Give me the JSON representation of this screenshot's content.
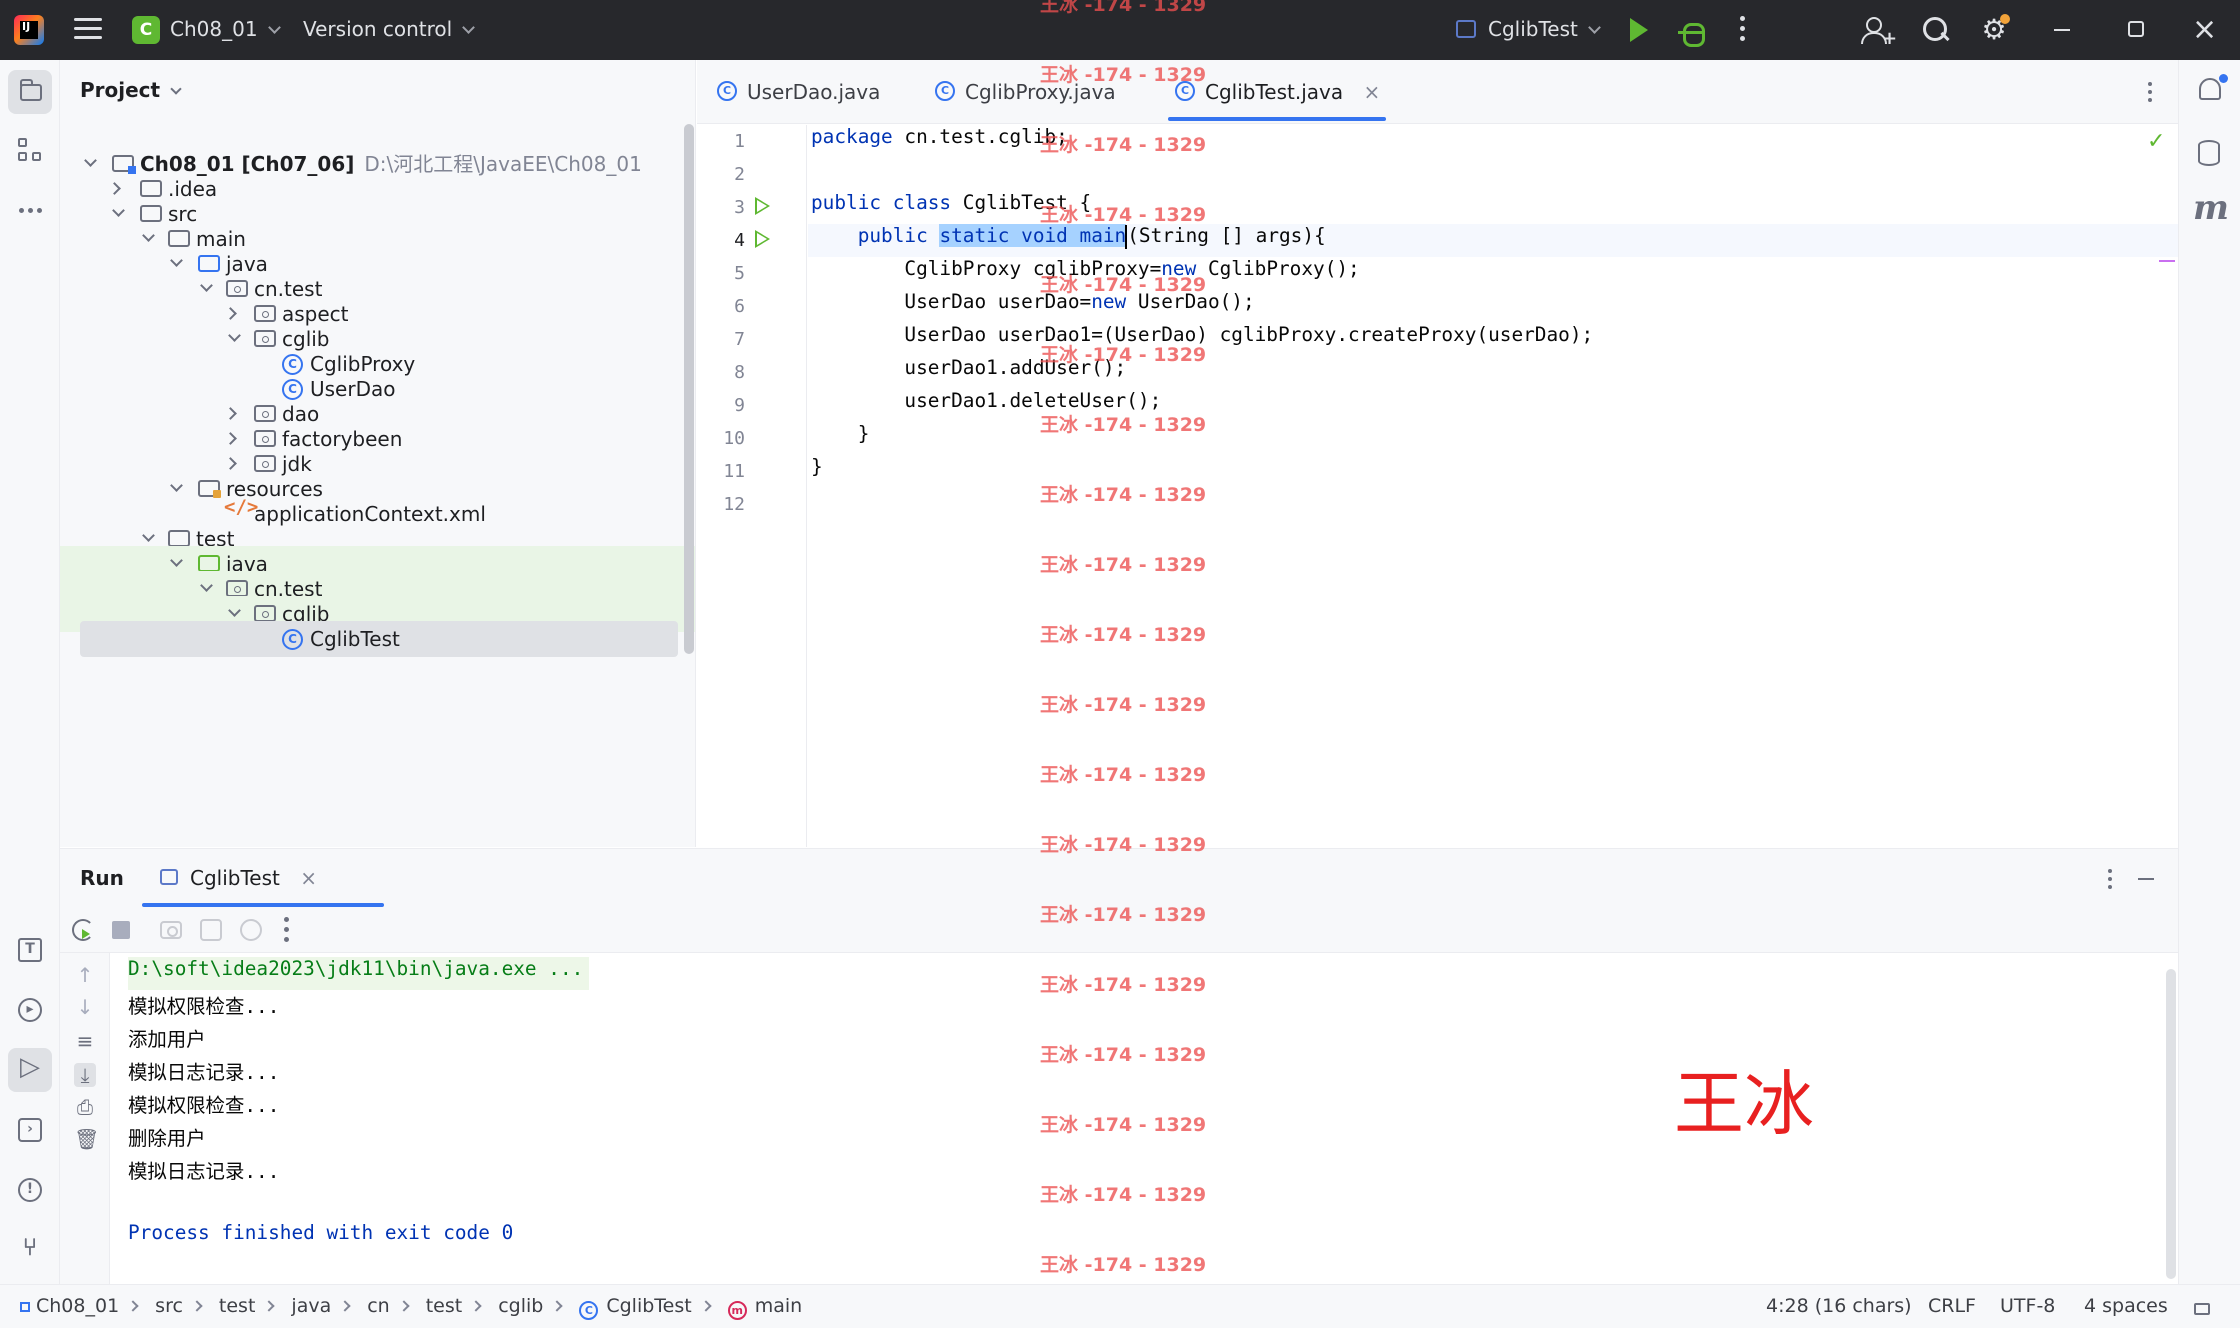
{
  "titlebar": {
    "project_badge": "C",
    "project_name": "Ch08_01",
    "vcs_label": "Version control",
    "run_config": "CglibTest"
  },
  "project_panel": {
    "title": "Project",
    "root_name": "Ch08_01 [Ch07_06]",
    "root_path": "D:\\河北工程\\JavaEE\\Ch08_01",
    "items": [
      {
        "label": "Ch08_01 [Ch07_06]",
        "kind": "module"
      },
      {
        "label": ".idea",
        "kind": "folder"
      },
      {
        "label": "src",
        "kind": "folder"
      },
      {
        "label": "main",
        "kind": "folder"
      },
      {
        "label": "java",
        "kind": "source-folder"
      },
      {
        "label": "cn.test",
        "kind": "package"
      },
      {
        "label": "aspect",
        "kind": "package"
      },
      {
        "label": "cglib",
        "kind": "package"
      },
      {
        "label": "CglibProxy",
        "kind": "class"
      },
      {
        "label": "UserDao",
        "kind": "class"
      },
      {
        "label": "dao",
        "kind": "package"
      },
      {
        "label": "factorybeen",
        "kind": "package"
      },
      {
        "label": "jdk",
        "kind": "package"
      },
      {
        "label": "resources",
        "kind": "resources-folder"
      },
      {
        "label": "applicationContext.xml",
        "kind": "xml"
      },
      {
        "label": "test",
        "kind": "folder"
      },
      {
        "label": "java",
        "kind": "test-folder"
      },
      {
        "label": "cn.test",
        "kind": "package"
      },
      {
        "label": "cglib",
        "kind": "package"
      },
      {
        "label": "CglibTest",
        "kind": "class"
      }
    ]
  },
  "editor": {
    "tabs": [
      {
        "label": "UserDao.java"
      },
      {
        "label": "CglibProxy.java"
      },
      {
        "label": "CglibTest.java",
        "active": true
      }
    ],
    "close_glyph": "×",
    "check_glyph": "✓",
    "line_numbers": [
      "1",
      "2",
      "3",
      "4",
      "5",
      "6",
      "7",
      "8",
      "9",
      "10",
      "11",
      "12"
    ],
    "code": {
      "l1_kw": "package",
      "l1_rest": " cn.test.cglib;",
      "l3_kw": "public class",
      "l3_rest": " CglibTest {",
      "l4_kw1": "public",
      "l4_sel": "static void main",
      "l4_rest": "(String [] args){",
      "l5_a": "CglibProxy cglibProxy=",
      "l5_kw": "new",
      "l5_b": " CglibProxy();",
      "l6_a": "UserDao userDao=",
      "l6_kw": "new",
      "l6_b": " UserDao();",
      "l7": "UserDao userDao1=(UserDao) cglibProxy.createProxy(userDao);",
      "l8": "userDao1.addUser();",
      "l9": "userDao1.deleteUser();",
      "l10": "}",
      "l11": "}"
    }
  },
  "run_panel": {
    "title": "Run",
    "tab_label": "CglibTest",
    "close_glyph": "×",
    "console": [
      "D:\\soft\\idea2023\\jdk11\\bin\\java.exe ...",
      "模拟权限检查...",
      "添加用户",
      "模拟日志记录...",
      "模拟权限检查...",
      "删除用户",
      "模拟日志记录..."
    ],
    "exit_line": "Process finished with exit code 0"
  },
  "statusbar": {
    "breadcrumb": [
      "Ch08_01",
      "src",
      "test",
      "java",
      "cn",
      "test",
      "cglib",
      "CglibTest",
      "main"
    ],
    "position": "4:28 (16 chars)",
    "line_sep": "CRLF",
    "encoding": "UTF-8",
    "indent": "4 spaces"
  },
  "watermark": {
    "text": "王冰 -174 - 1329",
    "big": "王冰"
  },
  "colors": {
    "accent": "#3574f0",
    "run_green": "#5fb832",
    "keyword": "#0033b3",
    "watermark": "#e82020"
  }
}
